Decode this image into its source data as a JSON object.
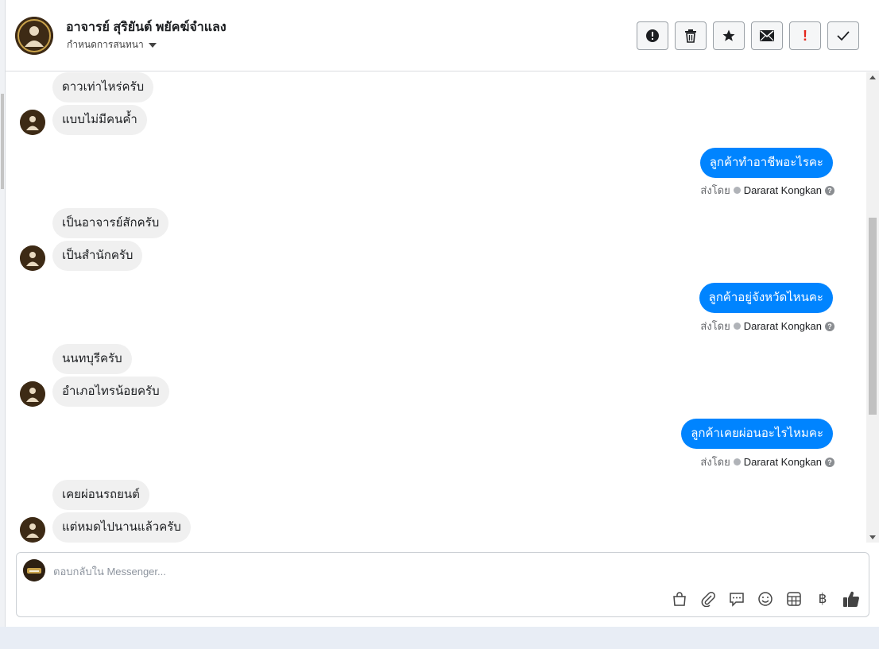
{
  "header": {
    "name": "อาจารย์ สุริยันต์ พยัคฆ์จำแลง",
    "subtitle": "กำหนดการสนทนา",
    "actions": [
      {
        "icon": "alert-circle-icon"
      },
      {
        "icon": "trash-icon"
      },
      {
        "icon": "star-icon"
      },
      {
        "icon": "envelope-icon"
      },
      {
        "icon": "exclamation-icon",
        "label": "!"
      },
      {
        "icon": "check-icon"
      }
    ]
  },
  "messages": [
    {
      "side": "in",
      "text": "ดาวเท่าไหร่ครับ"
    },
    {
      "side": "in",
      "text": "แบบไม่มีคนค้ำ"
    },
    {
      "side": "out",
      "text": "ลูกค้าทำอาชีพอะไรคะ",
      "sent_by_label": "ส่งโดย",
      "sender": "Dararat Kongkan"
    },
    {
      "side": "in",
      "text": "เป็นอาจารย์สักครับ"
    },
    {
      "side": "in",
      "text": "เป็นสำนักครับ"
    },
    {
      "side": "out",
      "text": "ลูกค้าอยู่จังหวัดไหนคะ",
      "sent_by_label": "ส่งโดย",
      "sender": "Dararat Kongkan"
    },
    {
      "side": "in",
      "text": "นนทบุรีครับ"
    },
    {
      "side": "in",
      "text": "อำเภอไทรน้อยครับ"
    },
    {
      "side": "out",
      "text": "ลูกค้าเคยผ่อนอะไรไหมคะ",
      "sent_by_label": "ส่งโดย",
      "sender": "Dararat Kongkan"
    },
    {
      "side": "in",
      "text": "เคยผ่อนรถยนต์"
    },
    {
      "side": "in",
      "text": "แต่หมดไปนานแล้วครับ"
    }
  ],
  "composer": {
    "placeholder": "ตอบกลับใน Messenger...",
    "tools": [
      "shopping-bag-icon",
      "paperclip-icon",
      "chat-bubble-icon",
      "smiley-icon",
      "table-icon",
      "baht-icon",
      "thumbs-up-icon"
    ],
    "baht_symbol": "฿"
  },
  "colors": {
    "outgoing_bubble": "#0084ff",
    "incoming_bubble": "#f0f0f0",
    "alert_red": "#e4261c"
  }
}
